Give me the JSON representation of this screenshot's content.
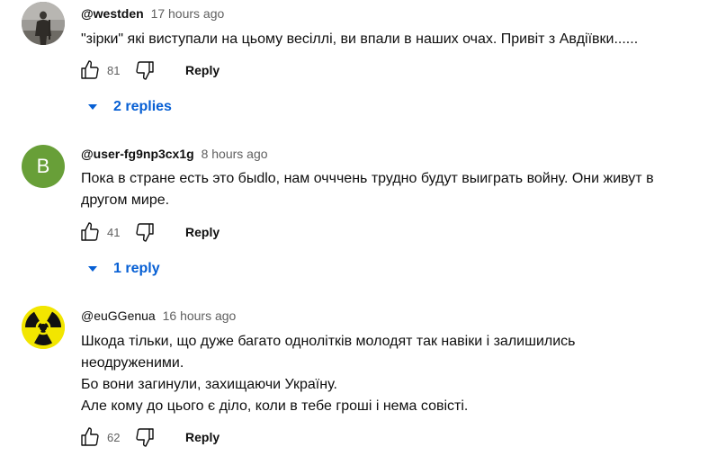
{
  "comments": [
    {
      "author": "@westden",
      "time": "17 hours ago",
      "text": "\"зірки\" які виступали на цьому весіллі, ви впали в наших очах. Привіт з Авдіївки......",
      "likes": "81",
      "reply_label": "Reply",
      "replies_label": "2 replies",
      "avatar_icon": "soldier-photo-icon"
    },
    {
      "author": "@user-fg9np3cx1g",
      "time": "8 hours ago",
      "text": "Пока в стране есть это быdlo, нам очччень трудно будут выиграть войну. Они живут в другом мире.",
      "likes": "41",
      "reply_label": "Reply",
      "replies_label": "1 reply",
      "avatar_letter": "B",
      "avatar_color": "#689f38"
    },
    {
      "author": "@euGGenua",
      "time": "16 hours ago",
      "text": "Шкода тільки, що дуже багато однолітків молодят так навіки і залишились неодруженими.\nБо вони загинули, захищаючи Україну.\nАле кому до цього є діло, коли в тебе гроші і нема совісті.",
      "likes": "62",
      "reply_label": "Reply",
      "avatar_icon": "radiation-symbol-icon"
    }
  ],
  "colors": {
    "link": "#065fd4",
    "secondary": "#606060",
    "text": "#0f0f0f"
  }
}
